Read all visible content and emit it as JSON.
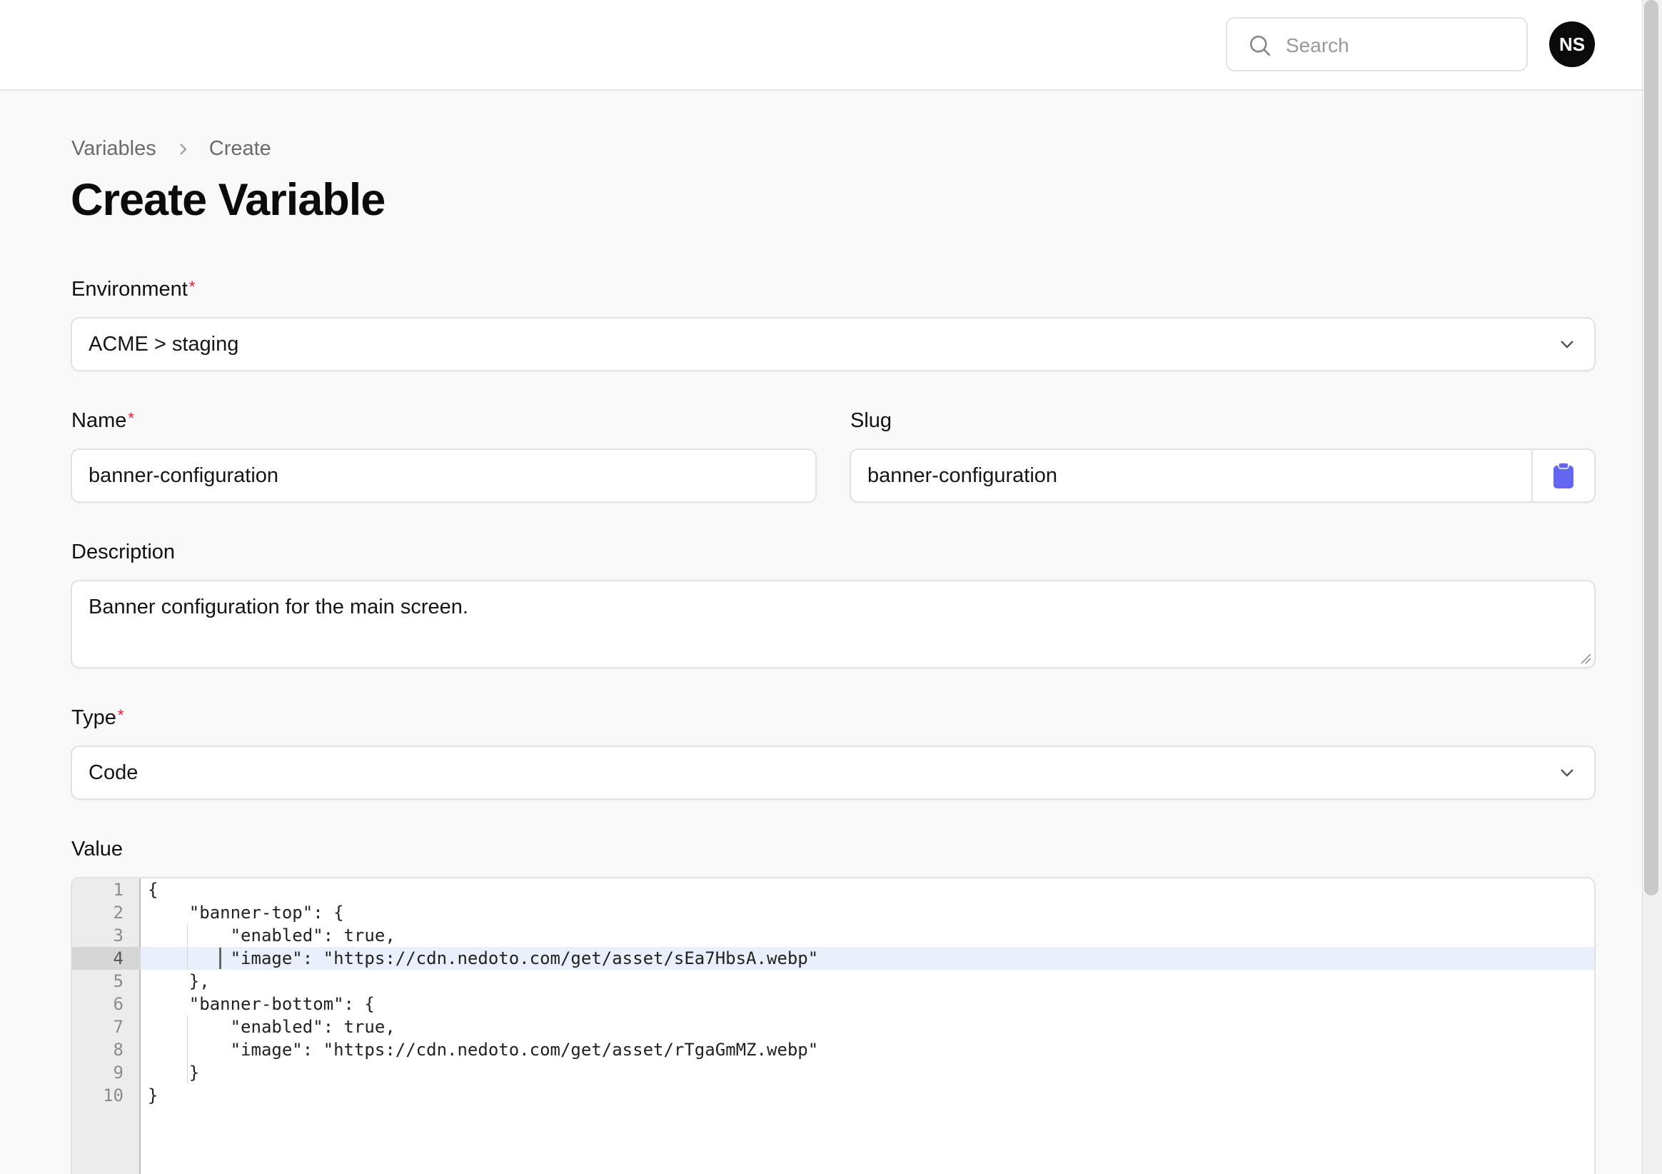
{
  "header": {
    "search_placeholder": "Search",
    "avatar_initials": "NS"
  },
  "breadcrumb": {
    "items": [
      "Variables",
      "Create"
    ]
  },
  "page": {
    "title": "Create Variable"
  },
  "form": {
    "environment": {
      "label": "Environment",
      "required_mark": "*",
      "value": "ACME > staging"
    },
    "name": {
      "label": "Name",
      "required_mark": "*",
      "value": "banner-configuration"
    },
    "slug": {
      "label": "Slug",
      "value": "banner-configuration",
      "copy_icon": "clipboard-icon"
    },
    "description": {
      "label": "Description",
      "value": "Banner configuration for the main screen."
    },
    "type": {
      "label": "Type",
      "required_mark": "*",
      "value": "Code"
    },
    "value": {
      "label": "Value",
      "lines": [
        {
          "n": "1",
          "text": "{"
        },
        {
          "n": "2",
          "text": "    \"banner-top\": {"
        },
        {
          "n": "3",
          "text": "        \"enabled\": true,"
        },
        {
          "n": "4",
          "text": "        \"image\": \"https://cdn.nedoto.com/get/asset/sEa7HbsA.webp\""
        },
        {
          "n": "5",
          "text": "    },"
        },
        {
          "n": "6",
          "text": "    \"banner-bottom\": {"
        },
        {
          "n": "7",
          "text": "        \"enabled\": true,"
        },
        {
          "n": "8",
          "text": "        \"image\": \"https://cdn.nedoto.com/get/asset/rTgaGmMZ.webp\""
        },
        {
          "n": "9",
          "text": "    }"
        },
        {
          "n": "10",
          "text": "}"
        }
      ],
      "active_line": 4
    }
  },
  "colors": {
    "accent": "#6366f1",
    "required": "#e11d2b",
    "active_line_bg": "#eaf0fb"
  }
}
